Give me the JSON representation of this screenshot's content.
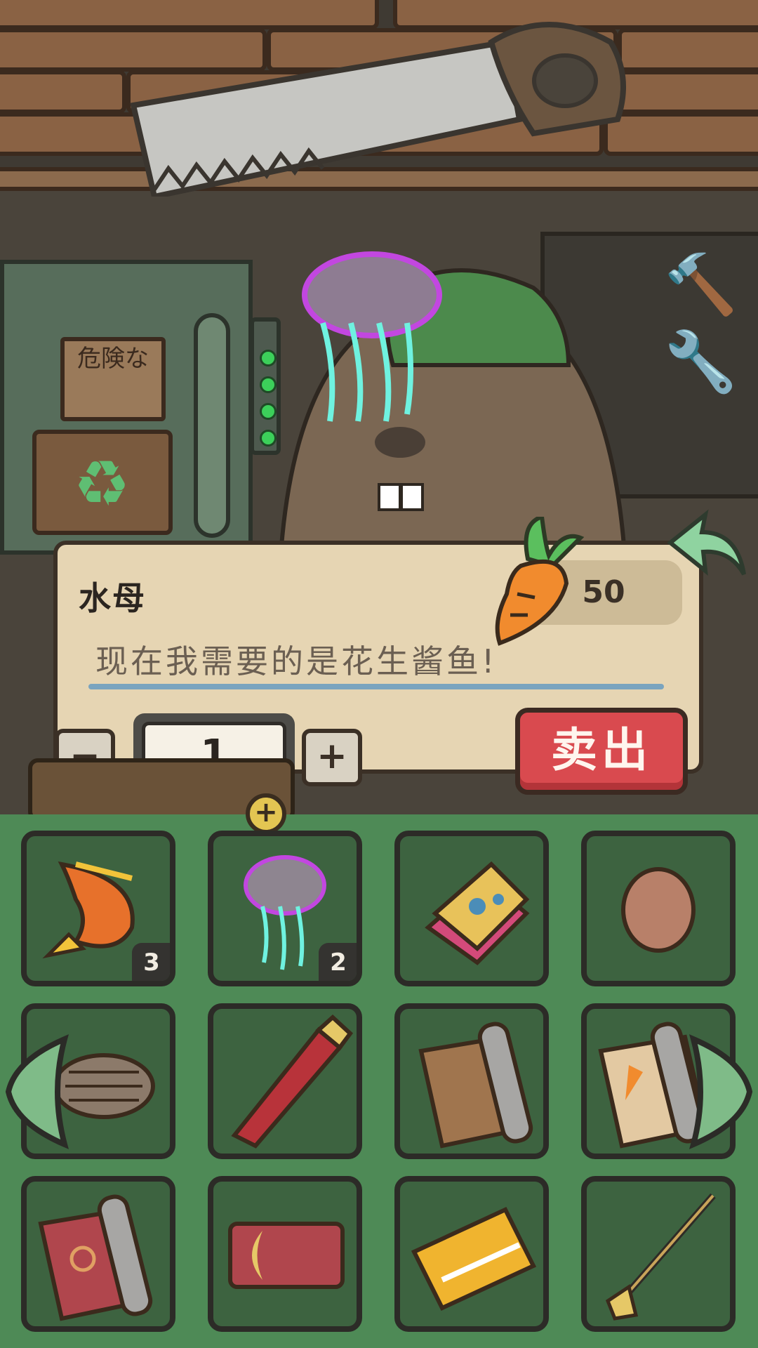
{
  "scene": {
    "sign_text": "危険な",
    "recycle_icon": "recycle-icon"
  },
  "dialog": {
    "item_name": "水母",
    "price": "50",
    "message": "现在我需要的是花生酱鱼!",
    "quantity": "1",
    "minus_label": "−",
    "plus_label": "+",
    "sell_label": "卖出"
  },
  "inventory": {
    "add_label": "+",
    "slots": [
      {
        "item": "fish-icon",
        "count": "3"
      },
      {
        "item": "jellyfish-icon",
        "count": "2"
      },
      {
        "item": "patterned-cloth-icon",
        "count": ""
      },
      {
        "item": "egg-icon",
        "count": ""
      },
      {
        "item": "yarn-spool-icon",
        "count": ""
      },
      {
        "item": "pen-icon",
        "count": ""
      },
      {
        "item": "paper-roll-icon",
        "count": ""
      },
      {
        "item": "carrot-scroll-icon",
        "count": ""
      },
      {
        "item": "red-scroll-icon",
        "count": ""
      },
      {
        "item": "moon-ticket-icon",
        "count": ""
      },
      {
        "item": "vip-card-icon",
        "count": ""
      },
      {
        "item": "fishing-rod-icon",
        "count": ""
      }
    ]
  },
  "colors": {
    "sell": "#d94a4f",
    "inventory_bg": "#4e8a56",
    "dialog_bg": "#e6d5b3"
  }
}
